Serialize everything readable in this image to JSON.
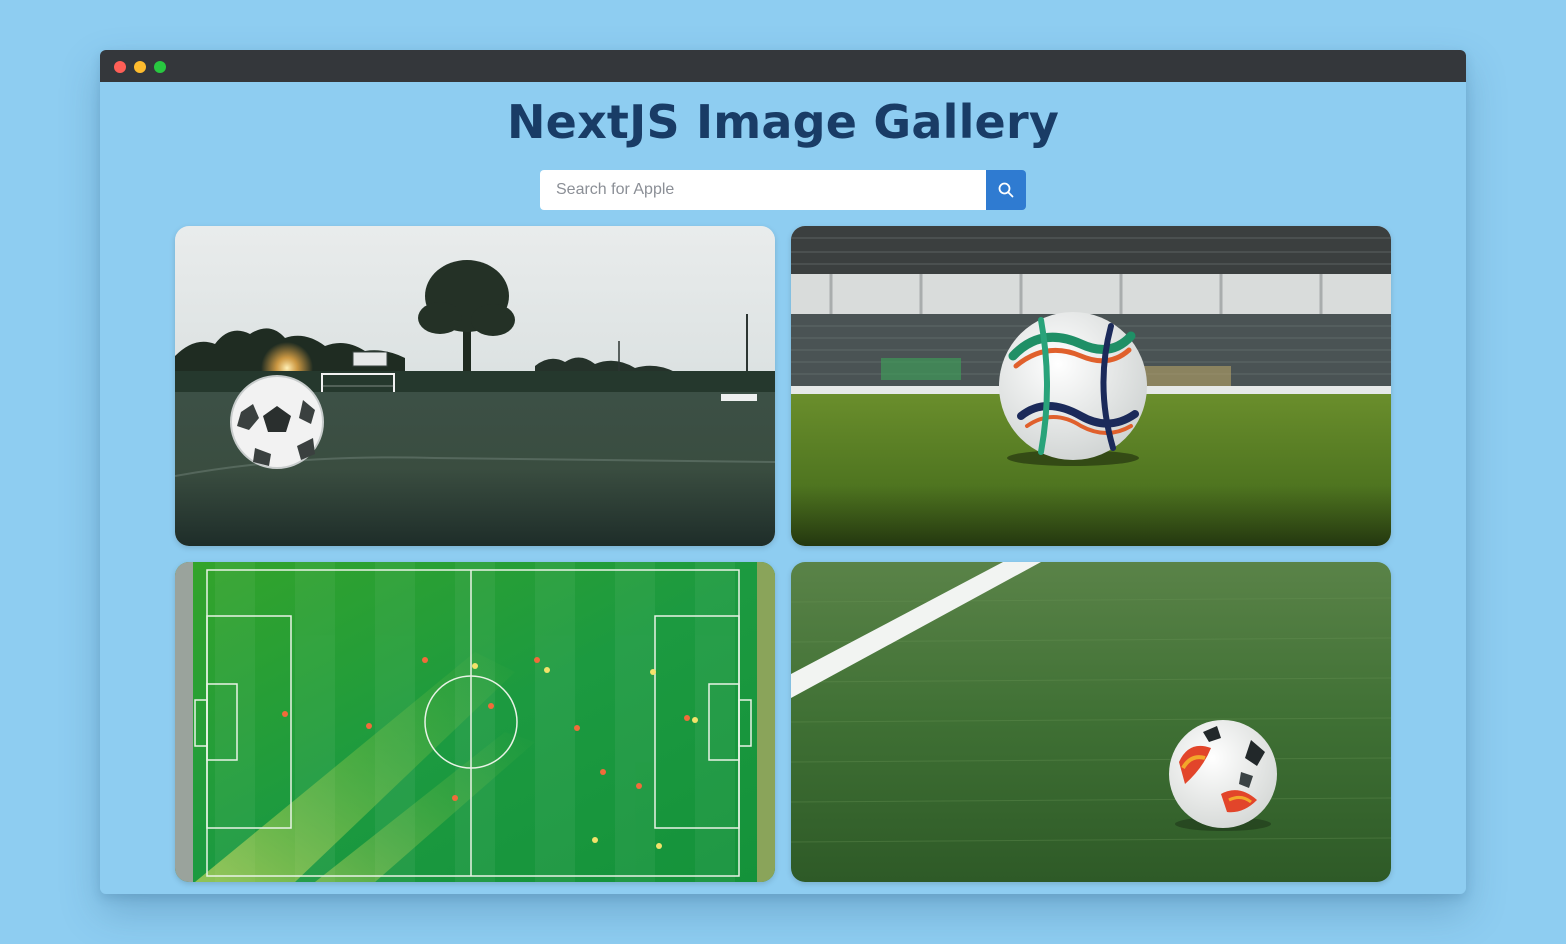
{
  "window": {
    "title_bar_buttons": [
      "close",
      "minimize",
      "maximize"
    ],
    "colors": {
      "close": "#ff5f57",
      "minimize": "#febc2e",
      "maximize": "#28c840",
      "titlebar": "#34373b"
    }
  },
  "header": {
    "title": "NextJS Image Gallery",
    "title_color": "#193c66"
  },
  "search": {
    "placeholder": "Search for Apple",
    "value": "",
    "button_icon": "search-icon",
    "button_color": "#2f7bd1"
  },
  "gallery": {
    "images": [
      {
        "subject": "soccer ball on grass field at sunset"
      },
      {
        "subject": "colorful soccer ball in stadium"
      },
      {
        "subject": "aerial view of soccer pitch"
      },
      {
        "subject": "soccer ball on turf near white line"
      }
    ]
  },
  "page_background": "#8ecdf1"
}
